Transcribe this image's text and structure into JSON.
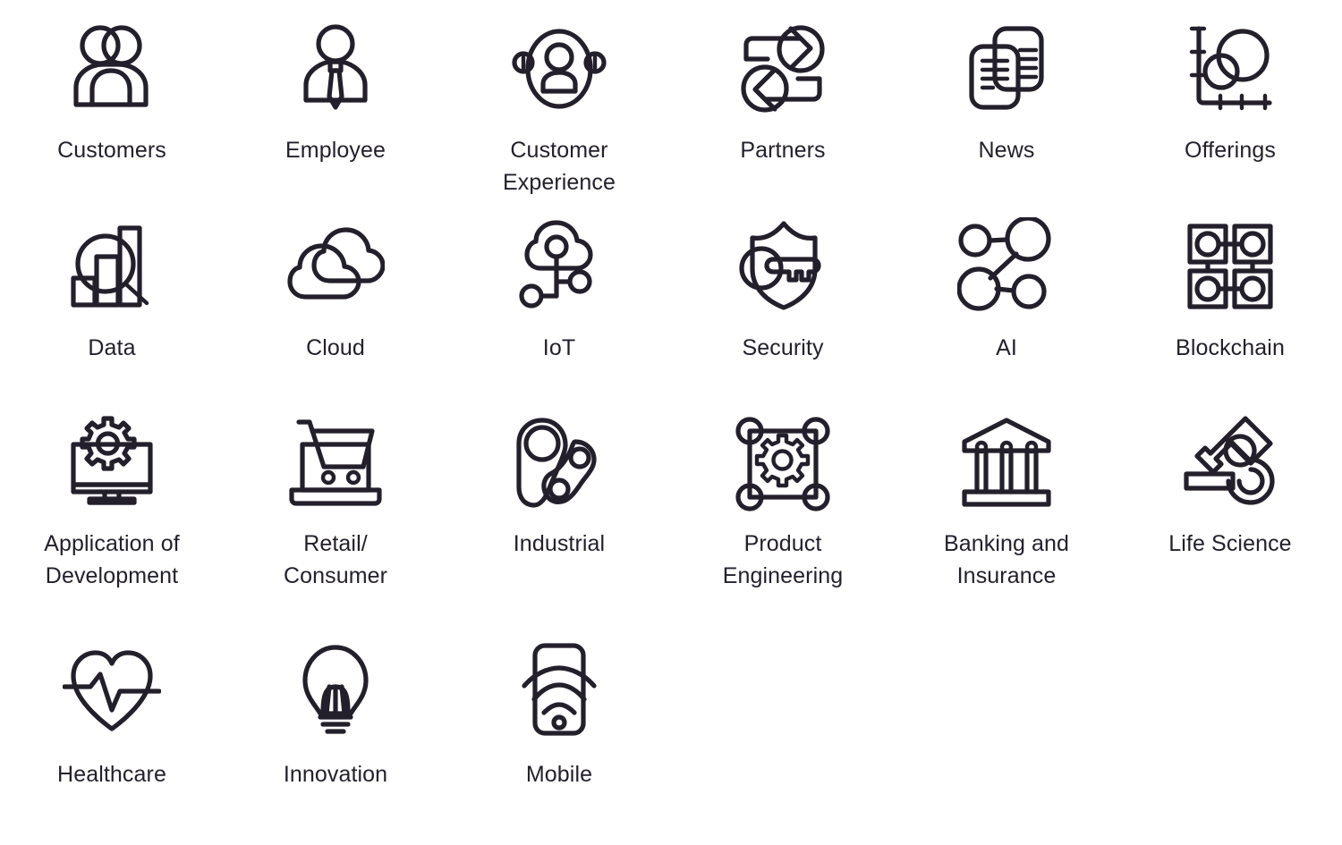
{
  "page": {
    "title": "Business and Technology Icon Set",
    "background_color": "#ffffff",
    "stroke_color": "#231f2b",
    "label_color": "#231f2b",
    "columns": 6,
    "rows": 4,
    "total_icons": 21
  },
  "icons": [
    {
      "id": "customers",
      "label": "Customers",
      "icon": "two-people-icon",
      "row": 1,
      "col": 1
    },
    {
      "id": "employee",
      "label": "Employee",
      "icon": "person-with-tie-icon",
      "row": 1,
      "col": 2
    },
    {
      "id": "customer-experience",
      "label": "Customer Experience",
      "icon": "person-in-circle-icon",
      "row": 1,
      "col": 3
    },
    {
      "id": "partners",
      "label": "Partners",
      "icon": "exchange-arrows-icon",
      "row": 1,
      "col": 4
    },
    {
      "id": "news",
      "label": "News",
      "icon": "documents-icon",
      "row": 1,
      "col": 5
    },
    {
      "id": "offerings",
      "label": "Offerings",
      "icon": "chart-circles-icon",
      "row": 1,
      "col": 6
    },
    {
      "id": "data",
      "label": "Data",
      "icon": "bar-chart-magnifier-icon",
      "row": 2,
      "col": 1
    },
    {
      "id": "cloud",
      "label": "Cloud",
      "icon": "cloud-icon",
      "row": 2,
      "col": 2
    },
    {
      "id": "iot",
      "label": "IoT",
      "icon": "cloud-network-icon",
      "row": 2,
      "col": 3
    },
    {
      "id": "security",
      "label": "Security",
      "icon": "shield-key-icon",
      "row": 2,
      "col": 4
    },
    {
      "id": "ai",
      "label": "AI",
      "icon": "neural-nodes-icon",
      "row": 2,
      "col": 5
    },
    {
      "id": "blockchain",
      "label": "Blockchain",
      "icon": "linked-blocks-icon",
      "row": 2,
      "col": 6
    },
    {
      "id": "application-of-development",
      "label": "Application of Development",
      "icon": "monitor-gear-icon",
      "row": 3,
      "col": 1
    },
    {
      "id": "retail-consumer",
      "label": "Retail/ Consumer",
      "icon": "laptop-cart-icon",
      "row": 3,
      "col": 2
    },
    {
      "id": "industrial",
      "label": "Industrial",
      "icon": "pulley-belt-icon",
      "row": 3,
      "col": 3
    },
    {
      "id": "product-engineering",
      "label": "Product Engineering",
      "icon": "gear-in-frame-icon",
      "row": 3,
      "col": 4
    },
    {
      "id": "banking-and-insurance",
      "label": "Banking and Insurance",
      "icon": "bank-building-icon",
      "row": 3,
      "col": 5
    },
    {
      "id": "life-science",
      "label": "Life Science",
      "icon": "microscope-icon",
      "row": 3,
      "col": 6
    },
    {
      "id": "healthcare",
      "label": "Healthcare",
      "icon": "heart-pulse-icon",
      "row": 4,
      "col": 1
    },
    {
      "id": "innovation",
      "label": "Innovation",
      "icon": "lightbulb-icon",
      "row": 4,
      "col": 2
    },
    {
      "id": "mobile",
      "label": "Mobile",
      "icon": "phone-signal-icon",
      "row": 4,
      "col": 3
    }
  ],
  "labels": {
    "customers": "Customers",
    "employee": "Employee",
    "customer_experience_line1": "Customer",
    "customer_experience_line2": "Experience",
    "partners": "Partners",
    "news": "News",
    "offerings": "Offerings",
    "data": "Data",
    "cloud": "Cloud",
    "iot": "IoT",
    "security": "Security",
    "ai": "AI",
    "blockchain": "Blockchain",
    "application_line1": "Application of",
    "application_line2": "Development",
    "retail_line1": "Retail/",
    "retail_line2": "Consumer",
    "industrial": "Industrial",
    "product_line1": "Product",
    "product_line2": "Engineering",
    "banking_line1": "Banking and",
    "banking_line2": "Insurance",
    "life_science": "Life Science",
    "healthcare": "Healthcare",
    "innovation": "Innovation",
    "mobile": "Mobile"
  }
}
